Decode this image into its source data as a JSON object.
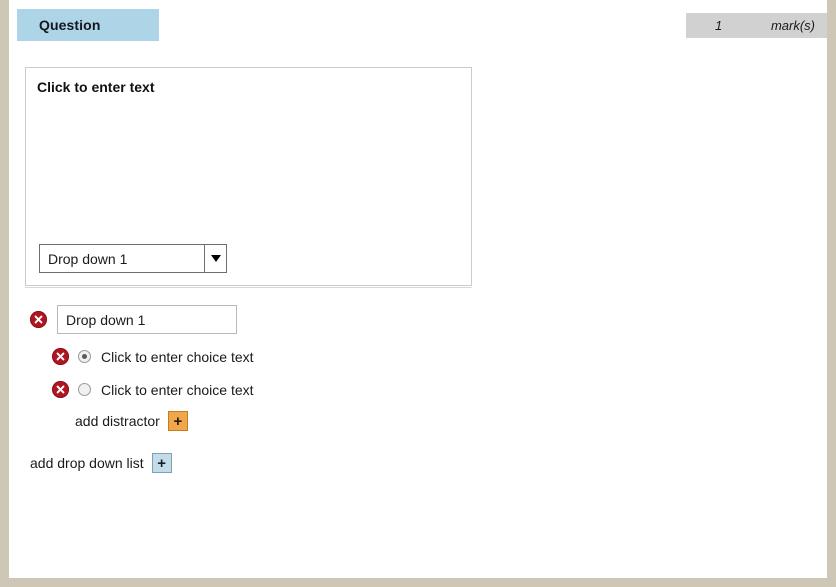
{
  "header": {
    "tab_label": "Question",
    "marks_value": "1",
    "marks_label": "mark(s)"
  },
  "question_body": {
    "prompt_placeholder": "Click to enter text",
    "preview_dropdown": {
      "selected": "Drop down 1",
      "caret_icon": "chevron-down-icon"
    }
  },
  "editor": {
    "dropdown": {
      "delete_icon": "delete-circle-icon",
      "name_value": "Drop down 1"
    },
    "choices": [
      {
        "delete_icon": "delete-circle-icon",
        "radio_icon": "radio-selected-icon",
        "selected": true,
        "label": "Click to enter choice text"
      },
      {
        "delete_icon": "delete-circle-icon",
        "radio_icon": "radio-unselected-icon",
        "selected": false,
        "label": "Click to enter choice text"
      }
    ],
    "add_distractor": {
      "label": "add distractor",
      "button_glyph": "+",
      "button_icon": "plus-icon"
    },
    "add_dropdown_list": {
      "label": "add drop down list",
      "button_glyph": "+",
      "button_icon": "plus-icon"
    }
  },
  "colors": {
    "tab_blue": "#aed4e8",
    "marks_gray": "#d1d1d1",
    "delete_red": "#b01622",
    "add_orange": "#f0a64a",
    "add_blue": "#c6dbe8",
    "page_border_tan": "#cfc7b5"
  }
}
